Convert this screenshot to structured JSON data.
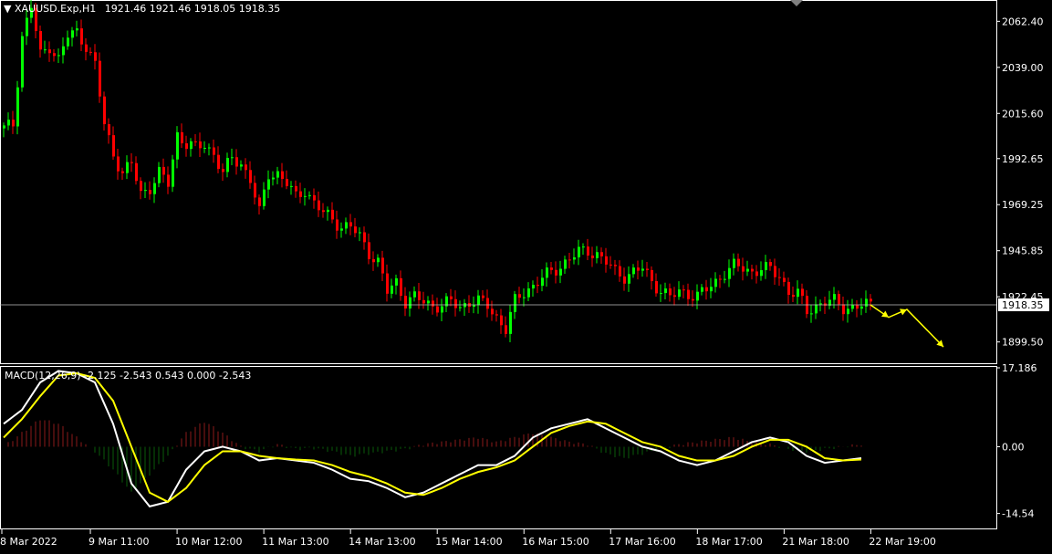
{
  "header": {
    "dropdown_icon": "triangle-down-icon",
    "symbol_label": "XAUUSD.Exp,H1",
    "ohlc_text": "1921.46 1921.46 1918.05 1918.35"
  },
  "indicator": {
    "label": "MACD(12,26,9) -2.125 -2.543 0.543 0.000 -2.543"
  },
  "colors": {
    "background": "#000000",
    "bull": "#00ff00",
    "bear": "#ff0000",
    "hist_pos": "#8b1a1a",
    "hist_neg": "#0a5c0a",
    "macd_line": "#ffffff",
    "signal_line": "#ffff00",
    "arrow": "#ffff00",
    "bid_line": "#c0c0c0"
  },
  "chart_data": {
    "type": "candlestick",
    "price_axis_ticks": [
      "2062.40",
      "2039.00",
      "2015.60",
      "1992.65",
      "1969.25",
      "1945.85",
      "1922.45",
      "1899.50"
    ],
    "price_axis_values": [
      2062.4,
      2039.0,
      2015.6,
      1992.65,
      1969.25,
      1945.85,
      1922.45,
      1899.5
    ],
    "current_price_label": "1918.35",
    "current_price": 1918.35,
    "macd_axis_ticks": [
      "17.186",
      "0.00",
      "-14.54"
    ],
    "macd_axis_values": [
      17.186,
      0.0,
      -14.54
    ],
    "time_labels": [
      "8 Mar 2022",
      "9 Mar 11:00",
      "10 Mar 12:00",
      "11 Mar 13:00",
      "14 Mar 13:00",
      "15 Mar 14:00",
      "16 Mar 15:00",
      "17 Mar 16:00",
      "18 Mar 17:00",
      "21 Mar 18:00",
      "22 Mar 19:00"
    ],
    "price_path": [
      [
        0,
        2008
      ],
      [
        2,
        2010
      ],
      [
        4,
        2055
      ],
      [
        6,
        2070
      ],
      [
        8,
        2045
      ],
      [
        10,
        2050
      ],
      [
        12,
        2043
      ],
      [
        14,
        2055
      ],
      [
        16,
        2057
      ],
      [
        18,
        2050
      ],
      [
        20,
        2040
      ],
      [
        22,
        2010
      ],
      [
        24,
        1995
      ],
      [
        26,
        1985
      ],
      [
        28,
        1990
      ],
      [
        30,
        1975
      ],
      [
        32,
        1978
      ],
      [
        34,
        1985
      ],
      [
        36,
        1980
      ],
      [
        38,
        2005
      ],
      [
        40,
        2000
      ],
      [
        42,
        1998
      ],
      [
        44,
        2000
      ],
      [
        46,
        1995
      ],
      [
        48,
        1985
      ],
      [
        50,
        1993
      ],
      [
        52,
        1990
      ],
      [
        54,
        1982
      ],
      [
        56,
        1965
      ],
      [
        58,
        1985
      ],
      [
        60,
        1985
      ],
      [
        62,
        1980
      ],
      [
        64,
        1973
      ],
      [
        66,
        1977
      ],
      [
        68,
        1970
      ],
      [
        70,
        1965
      ],
      [
        72,
        1962
      ],
      [
        74,
        1958
      ],
      [
        76,
        1958
      ],
      [
        78,
        1953
      ],
      [
        80,
        1945
      ],
      [
        82,
        1940
      ],
      [
        84,
        1925
      ],
      [
        86,
        1930
      ],
      [
        88,
        1920
      ],
      [
        90,
        1922
      ],
      [
        92,
        1920
      ],
      [
        94,
        1918
      ],
      [
        96,
        1918
      ],
      [
        98,
        1920
      ],
      [
        100,
        1917
      ],
      [
        102,
        1920
      ],
      [
        104,
        1920
      ],
      [
        106,
        1918
      ],
      [
        108,
        1912
      ],
      [
        110,
        1906
      ],
      [
        112,
        1920
      ],
      [
        114,
        1925
      ],
      [
        116,
        1928
      ],
      [
        118,
        1932
      ],
      [
        120,
        1935
      ],
      [
        122,
        1938
      ],
      [
        124,
        1942
      ],
      [
        126,
        1945
      ],
      [
        128,
        1946
      ],
      [
        130,
        1944
      ],
      [
        132,
        1940
      ],
      [
        134,
        1935
      ],
      [
        136,
        1933
      ],
      [
        138,
        1935
      ],
      [
        140,
        1937
      ],
      [
        142,
        1930
      ],
      [
        144,
        1926
      ],
      [
        146,
        1922
      ],
      [
        148,
        1925
      ],
      [
        150,
        1924
      ],
      [
        152,
        1923
      ],
      [
        154,
        1926
      ],
      [
        156,
        1930
      ],
      [
        158,
        1935
      ],
      [
        160,
        1938
      ],
      [
        162,
        1937
      ],
      [
        164,
        1935
      ],
      [
        166,
        1937
      ],
      [
        168,
        1936
      ],
      [
        170,
        1933
      ],
      [
        172,
        1925
      ],
      [
        174,
        1924
      ],
      [
        176,
        1915
      ],
      [
        178,
        1918
      ],
      [
        180,
        1920
      ],
      [
        182,
        1920
      ],
      [
        184,
        1917
      ],
      [
        186,
        1917
      ],
      [
        188,
        1918
      ],
      [
        190,
        1918.35
      ]
    ],
    "macd_path": [
      [
        0,
        5
      ],
      [
        4,
        8
      ],
      [
        8,
        14
      ],
      [
        12,
        16.5
      ],
      [
        16,
        16
      ],
      [
        20,
        14
      ],
      [
        24,
        5
      ],
      [
        28,
        -8
      ],
      [
        32,
        -13
      ],
      [
        36,
        -12
      ],
      [
        40,
        -5
      ],
      [
        44,
        -1
      ],
      [
        48,
        0
      ],
      [
        52,
        -1
      ],
      [
        56,
        -3
      ],
      [
        60,
        -2.5
      ],
      [
        64,
        -3
      ],
      [
        68,
        -3.5
      ],
      [
        72,
        -5
      ],
      [
        76,
        -7
      ],
      [
        80,
        -7.5
      ],
      [
        84,
        -9
      ],
      [
        88,
        -11
      ],
      [
        92,
        -10
      ],
      [
        96,
        -8
      ],
      [
        100,
        -6
      ],
      [
        104,
        -4
      ],
      [
        108,
        -4
      ],
      [
        112,
        -2
      ],
      [
        116,
        2
      ],
      [
        120,
        4
      ],
      [
        124,
        5
      ],
      [
        128,
        6
      ],
      [
        132,
        4
      ],
      [
        136,
        2
      ],
      [
        140,
        0
      ],
      [
        144,
        -1
      ],
      [
        148,
        -3
      ],
      [
        152,
        -4
      ],
      [
        156,
        -3
      ],
      [
        160,
        -1
      ],
      [
        164,
        1
      ],
      [
        168,
        2
      ],
      [
        172,
        1
      ],
      [
        176,
        -2
      ],
      [
        180,
        -3.5
      ],
      [
        184,
        -3
      ],
      [
        188,
        -2.5
      ]
    ],
    "signal_path": [
      [
        0,
        2
      ],
      [
        4,
        6
      ],
      [
        8,
        11
      ],
      [
        12,
        15.5
      ],
      [
        16,
        16
      ],
      [
        20,
        15
      ],
      [
        24,
        10
      ],
      [
        28,
        0
      ],
      [
        32,
        -10
      ],
      [
        36,
        -12
      ],
      [
        40,
        -9
      ],
      [
        44,
        -4
      ],
      [
        48,
        -1
      ],
      [
        52,
        -1
      ],
      [
        56,
        -2
      ],
      [
        60,
        -2.5
      ],
      [
        64,
        -2.8
      ],
      [
        68,
        -3
      ],
      [
        72,
        -4
      ],
      [
        76,
        -5.5
      ],
      [
        80,
        -6.5
      ],
      [
        84,
        -8
      ],
      [
        88,
        -10
      ],
      [
        92,
        -10.5
      ],
      [
        96,
        -9
      ],
      [
        100,
        -7
      ],
      [
        104,
        -5.5
      ],
      [
        108,
        -4.5
      ],
      [
        112,
        -3
      ],
      [
        116,
        0
      ],
      [
        120,
        3
      ],
      [
        124,
        4.5
      ],
      [
        128,
        5.5
      ],
      [
        132,
        5
      ],
      [
        136,
        3
      ],
      [
        140,
        1
      ],
      [
        144,
        0
      ],
      [
        148,
        -2
      ],
      [
        152,
        -3
      ],
      [
        156,
        -3
      ],
      [
        160,
        -2
      ],
      [
        164,
        0
      ],
      [
        168,
        1.5
      ],
      [
        172,
        1.5
      ],
      [
        176,
        0
      ],
      [
        180,
        -2.5
      ],
      [
        184,
        -3
      ],
      [
        188,
        -2.8
      ]
    ],
    "histogram_path": [
      [
        0,
        0
      ],
      [
        8,
        6
      ],
      [
        12,
        5
      ],
      [
        16,
        2
      ],
      [
        20,
        -1
      ],
      [
        24,
        -5
      ],
      [
        28,
        -10
      ],
      [
        32,
        -6
      ],
      [
        36,
        -2
      ],
      [
        40,
        3
      ],
      [
        44,
        5.5
      ],
      [
        48,
        3
      ],
      [
        52,
        0
      ],
      [
        56,
        -1
      ],
      [
        60,
        0.5
      ],
      [
        64,
        -0.5
      ],
      [
        68,
        -0.3
      ],
      [
        72,
        -1
      ],
      [
        76,
        -2
      ],
      [
        80,
        -1.5
      ],
      [
        84,
        -1
      ],
      [
        88,
        -0.5
      ],
      [
        92,
        0.5
      ],
      [
        96,
        1
      ],
      [
        100,
        1.5
      ],
      [
        104,
        2
      ],
      [
        108,
        1
      ],
      [
        112,
        2
      ],
      [
        116,
        3
      ],
      [
        120,
        2
      ],
      [
        124,
        1
      ],
      [
        128,
        0.5
      ],
      [
        132,
        -1.5
      ],
      [
        136,
        -2.5
      ],
      [
        140,
        -1.5
      ],
      [
        144,
        -0.5
      ],
      [
        148,
        0.5
      ],
      [
        152,
        1
      ],
      [
        156,
        1.5
      ],
      [
        160,
        2
      ],
      [
        164,
        1
      ],
      [
        168,
        0.5
      ],
      [
        172,
        -0.5
      ],
      [
        176,
        -1
      ],
      [
        180,
        -0.5
      ],
      [
        184,
        0
      ],
      [
        188,
        0.5
      ]
    ],
    "forecast_arrow_path": [
      [
        190,
        1918.35
      ],
      [
        194,
        1912
      ],
      [
        198,
        1916
      ],
      [
        206,
        1897
      ]
    ]
  }
}
